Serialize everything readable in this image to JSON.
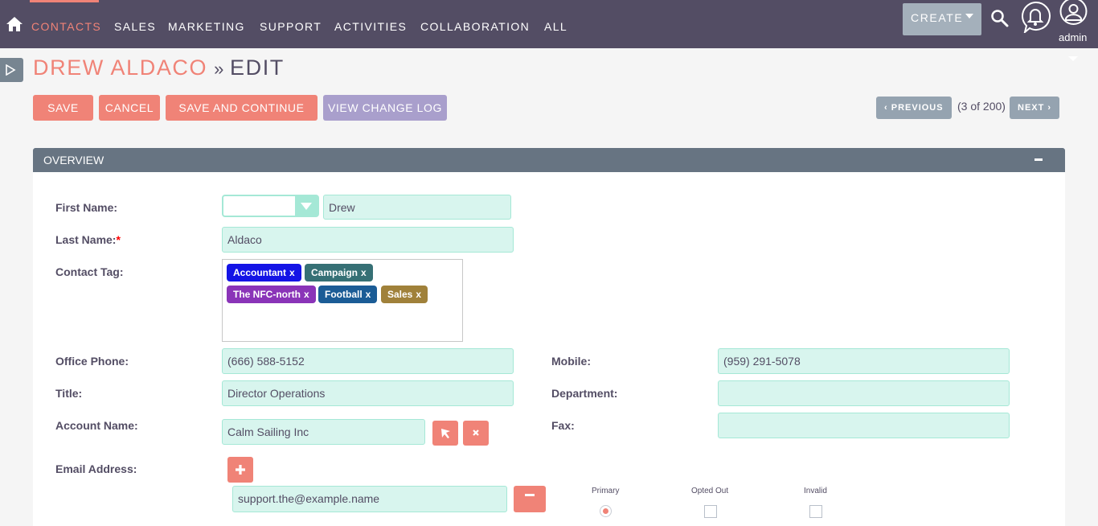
{
  "nav": {
    "items": [
      {
        "label": "CONTACTS",
        "active": true
      },
      {
        "label": "SALES",
        "active": false
      },
      {
        "label": "MARKETING",
        "active": false
      },
      {
        "label": "SUPPORT",
        "active": false
      },
      {
        "label": "ACTIVITIES",
        "active": false
      },
      {
        "label": "COLLABORATION",
        "active": false
      },
      {
        "label": "ALL",
        "active": false
      }
    ],
    "create_label": "CREATE",
    "user_label": "admin"
  },
  "header": {
    "record_name": "DREW ALDACO",
    "separator": "»",
    "mode": "EDIT"
  },
  "actions": {
    "save": "SAVE",
    "cancel": "CANCEL",
    "save_continue": "SAVE AND CONTINUE",
    "view_change_log": "VIEW CHANGE LOG"
  },
  "pager": {
    "previous": "PREVIOUS",
    "count": "(3 of 200)",
    "next": "NEXT"
  },
  "panel": {
    "title": "OVERVIEW"
  },
  "form": {
    "first_name": {
      "label": "First Name:",
      "salutation": "",
      "value": "Drew"
    },
    "last_name": {
      "label": "Last Name:",
      "required_marker": "*",
      "value": "Aldaco"
    },
    "contact_tag": {
      "label": "Contact Tag:",
      "tags": [
        {
          "label": "Accountant",
          "remove": "x",
          "color": "#1414e6"
        },
        {
          "label": "Campaign",
          "remove": "x",
          "color": "#367075"
        },
        {
          "label": "The NFC-north",
          "remove": "x",
          "color": "#8a34b8"
        },
        {
          "label": "Football",
          "remove": "x",
          "color": "#1b5c96"
        },
        {
          "label": "Sales",
          "remove": "x",
          "color": "#a0813a"
        }
      ]
    },
    "office_phone": {
      "label": "Office Phone:",
      "value": "(666) 588-5152"
    },
    "mobile": {
      "label": "Mobile:",
      "value": "(959) 291-5078"
    },
    "title": {
      "label": "Title:",
      "value": "Director Operations"
    },
    "department": {
      "label": "Department:",
      "value": ""
    },
    "account_name": {
      "label": "Account Name:",
      "value": "Calm Sailing Inc"
    },
    "fax": {
      "label": "Fax:",
      "value": ""
    },
    "email": {
      "label": "Email Address:",
      "value": "support.the@example.name",
      "primary_label": "Primary",
      "opted_out_label": "Opted Out",
      "invalid_label": "Invalid",
      "primary": true,
      "opted_out": false,
      "invalid": false
    }
  },
  "colors": {
    "nav_bg": "#534d64",
    "accent": "#f08377",
    "secondary_button": "#a99fcc",
    "panel_header": "#677482",
    "field_bg": "#d8f5ee",
    "field_border": "#a5e8d6"
  }
}
